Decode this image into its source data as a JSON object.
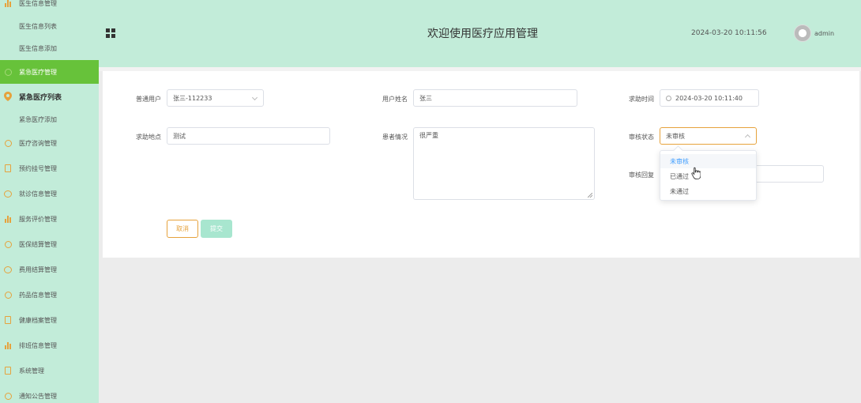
{
  "sidebar": {
    "items": [
      {
        "label": "医生信息管理",
        "icon": "bar-chart-icon"
      },
      {
        "label": "医生信息列表"
      },
      {
        "label": "医生信息添加"
      },
      {
        "label": "紧急医疗管理",
        "icon": "circle-icon"
      },
      {
        "label": "紧急医疗列表",
        "icon": "location-pin-icon"
      },
      {
        "label": "紧急医疗添加"
      },
      {
        "label": "医疗咨询管理",
        "icon": "check-circle-icon"
      },
      {
        "label": "预约挂号管理",
        "icon": "document-icon"
      },
      {
        "label": "就诊信息管理",
        "icon": "chat-icon"
      },
      {
        "label": "服务评价管理",
        "icon": "bar-chart-icon"
      },
      {
        "label": "医保结算管理",
        "icon": "check-circle-icon"
      },
      {
        "label": "费用结算管理",
        "icon": "chat-icon"
      },
      {
        "label": "药品信息管理",
        "icon": "check-circle-icon"
      },
      {
        "label": "健康档案管理",
        "icon": "document-icon"
      },
      {
        "label": "排班信息管理",
        "icon": "bar-chart-icon"
      },
      {
        "label": "系统管理",
        "icon": "document-icon"
      },
      {
        "label": "通知公告管理",
        "icon": "check-circle-icon"
      }
    ]
  },
  "header": {
    "title": "欢迎使用医疗应用管理",
    "datetime": "2024-03-20 10:11:56",
    "username": "admin"
  },
  "form": {
    "user_label": "普通用户",
    "user_value": "张三-112233",
    "name_label": "用户姓名",
    "name_value": "张三",
    "time_label": "求助时间",
    "time_value": "2024-03-20 10:11:40",
    "location_label": "求助地点",
    "location_value": "测试",
    "condition_label": "患者情况",
    "condition_value": "很严重",
    "status_label": "审核状态",
    "status_value": "未审核",
    "reply_label": "审核回复",
    "cancel_label": "取消",
    "submit_label": "提交"
  },
  "dropdown": {
    "options": [
      "未审核",
      "已通过",
      "未通过"
    ],
    "selected": "未审核"
  },
  "colors": {
    "sidebar_bg": "#c2ecd9",
    "active_bg": "#67c23a",
    "accent_orange": "#e6a23c",
    "selected_blue": "#409eff",
    "submit_bg": "#a8e6cf"
  }
}
